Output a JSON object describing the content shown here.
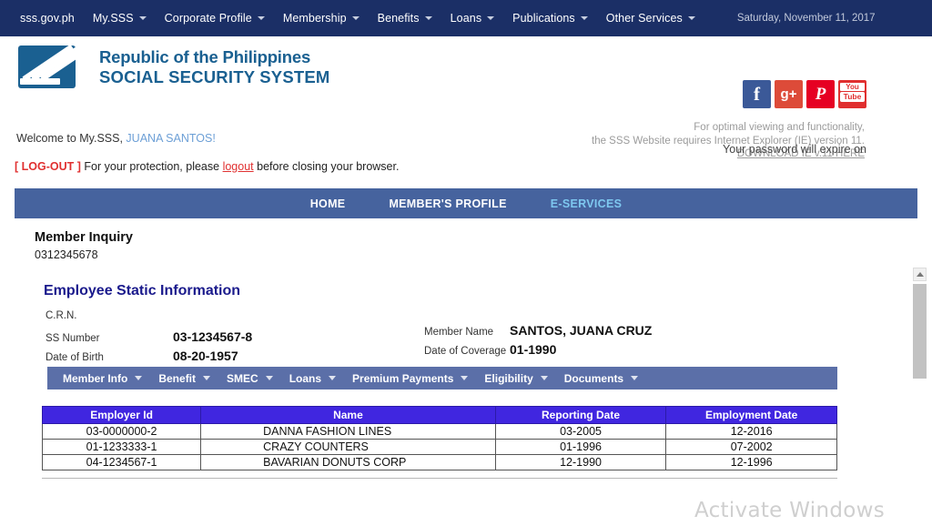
{
  "topnav": {
    "items": [
      {
        "label": "sss.gov.ph",
        "caret": false
      },
      {
        "label": "My.SSS",
        "caret": true
      },
      {
        "label": "Corporate Profile",
        "caret": true
      },
      {
        "label": "Membership",
        "caret": true
      },
      {
        "label": "Benefits",
        "caret": true
      },
      {
        "label": "Loans",
        "caret": true
      },
      {
        "label": "Publications",
        "caret": true
      },
      {
        "label": "Other Services",
        "caret": true
      }
    ],
    "date": "Saturday, November 11, 2017"
  },
  "brand": {
    "line1": "Republic of the Philippines",
    "line2": "SOCIAL SECURITY SYSTEM",
    "logo_icon": "sss-logo-icon"
  },
  "social": [
    {
      "name": "facebook-icon",
      "glyph": "f"
    },
    {
      "name": "google-plus-icon",
      "glyph": "g+"
    },
    {
      "name": "pinterest-icon",
      "glyph": "P"
    },
    {
      "name": "youtube-icon",
      "glyph_top": "You",
      "glyph_bottom": "Tube"
    }
  ],
  "ie_note": {
    "line1": "For optimal viewing and functionality,",
    "line2": "the SSS Website requires Internet Explorer (IE) version 11.",
    "link": "DOWNLOAD IE v.11 HERE"
  },
  "welcome": {
    "greeting": "Welcome to My.SSS,",
    "user": "JUANA SANTOS!",
    "logout_tag": "[ LOG-OUT ]",
    "logout_text_before": "For your protection, please",
    "logout_link": "logout",
    "logout_text_after": "before closing your browser.",
    "password_expire": "Your password will expire on"
  },
  "mainnav": {
    "items": [
      {
        "label": "HOME",
        "active": false
      },
      {
        "label": "MEMBER'S PROFILE",
        "active": false
      },
      {
        "label": "E-SERVICES",
        "active": true
      }
    ]
  },
  "page": {
    "title": "Member Inquiry",
    "subtitle": "0312345678",
    "section_title": "Employee Static Information"
  },
  "fields": {
    "left": [
      {
        "label": "C.R.N.",
        "value": ""
      },
      {
        "label": "SS Number",
        "value": "03-1234567-8"
      },
      {
        "label": "Date of Birth",
        "value": "08-20-1957"
      }
    ],
    "right": [
      {
        "label": "Member Name",
        "value": "SANTOS, JUANA CRUZ"
      },
      {
        "label": "Date of Coverage",
        "value": "01-1990"
      }
    ]
  },
  "submenu": {
    "items": [
      {
        "label": "Member Info"
      },
      {
        "label": "Benefit"
      },
      {
        "label": "SMEC"
      },
      {
        "label": "Loans"
      },
      {
        "label": "Premium Payments"
      },
      {
        "label": "Eligibility"
      },
      {
        "label": "Documents"
      }
    ]
  },
  "table": {
    "headers": [
      "Employer Id",
      "Name",
      "Reporting Date",
      "Employment Date"
    ],
    "rows": [
      {
        "employer_id": "03-0000000-2",
        "name": "DANNA FASHION LINES",
        "reporting_date": "03-2005",
        "employment_date": "12-2016"
      },
      {
        "employer_id": "01-1233333-1",
        "name": "CRAZY COUNTERS",
        "reporting_date": "01-1996",
        "employment_date": "07-2002"
      },
      {
        "employer_id": "04-1234567-1",
        "name": "BAVARIAN DONUTS CORP",
        "reporting_date": "12-1990",
        "employment_date": "12-1996"
      }
    ]
  },
  "scrollbar": {
    "up_icon": "scroll-up-arrow-icon"
  },
  "watermark": "Activate Windows",
  "colors": {
    "topnav_bg": "#1b2f66",
    "mainnav_bg": "#46639e",
    "mainnav_active": "#7ec8f0",
    "submenu_bg": "#5b6fa8",
    "table_header_bg": "#4026e0",
    "brand_blue": "#1a6091",
    "section_title": "#1a1a8c",
    "logout_red": "#e03030"
  }
}
